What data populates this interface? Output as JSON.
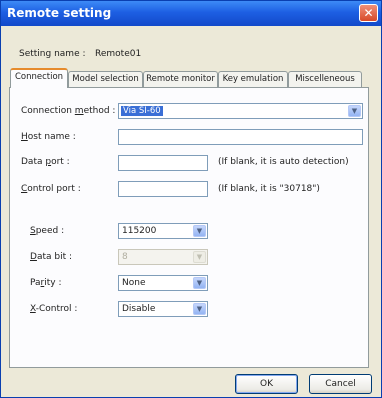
{
  "window": {
    "title": "Remote setting",
    "close_glyph": "✕"
  },
  "setting_name": {
    "label": "Setting name :",
    "value": "Remote01"
  },
  "tabs": [
    {
      "label": "Connection",
      "active": true
    },
    {
      "label": "Model selection",
      "active": false
    },
    {
      "label": "Remote monitor",
      "active": false
    },
    {
      "label": "Key emulation",
      "active": false
    },
    {
      "label": "Miscelleneous",
      "active": false
    }
  ],
  "connection": {
    "method_label_pre": "Connection ",
    "method_label_u": "m",
    "method_label_post": "ethod :",
    "method_value": "Via SI-60",
    "host_label_u": "H",
    "host_label_post": "ost name :",
    "host_value": "",
    "data_port_label_pre": "Data ",
    "data_port_label_u": "p",
    "data_port_label_post": "ort :",
    "data_port_value": "",
    "data_port_hint": "(If blank, it is auto detection)",
    "control_port_label_u": "C",
    "control_port_label_post": "ontrol port :",
    "control_port_value": "",
    "control_port_hint": "(If blank, it is \"30718\")"
  },
  "serial": {
    "speed_label_u": "S",
    "speed_label_post": "peed :",
    "speed_value": "115200",
    "data_bit_label_u": "D",
    "data_bit_label_post": "ata bit :",
    "data_bit_value": "8",
    "parity_label_pre": "Pa",
    "parity_label_u": "r",
    "parity_label_post": "ity :",
    "parity_value": "None",
    "xcontrol_label_u": "X",
    "xcontrol_label_post": "-Control :",
    "xcontrol_value": "Disable"
  },
  "buttons": {
    "ok": "OK",
    "cancel": "Cancel"
  },
  "icons": {
    "dropdown_arrow": "▼"
  },
  "colors": {
    "titlebar": "#1d5fe3",
    "window_bg": "#ece9d8",
    "active_tab_accent": "#e68b2c",
    "selection": "#3a6fd6"
  }
}
